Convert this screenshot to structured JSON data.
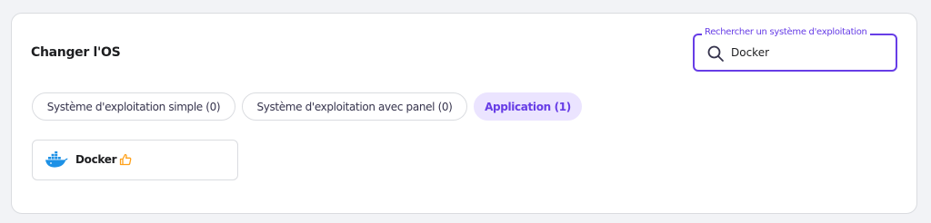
{
  "section": {
    "title": "Changer l'OS"
  },
  "search": {
    "label": "Rechercher un système d'exploitation",
    "value": "Docker",
    "icon": "search-icon"
  },
  "filters": [
    {
      "label": "Système d'exploitation simple (0)",
      "active": false
    },
    {
      "label": "Système d'exploitation avec panel (0)",
      "active": false
    },
    {
      "label": "Application (1)",
      "active": true
    }
  ],
  "results": [
    {
      "name": "Docker",
      "logo": "docker-logo",
      "badge": "thumbs-up-icon"
    }
  ],
  "colors": {
    "accent": "#673de6",
    "accent_light": "#ebe4ff",
    "docker_blue": "#1d91e6",
    "badge_orange": "#ffa11a"
  }
}
